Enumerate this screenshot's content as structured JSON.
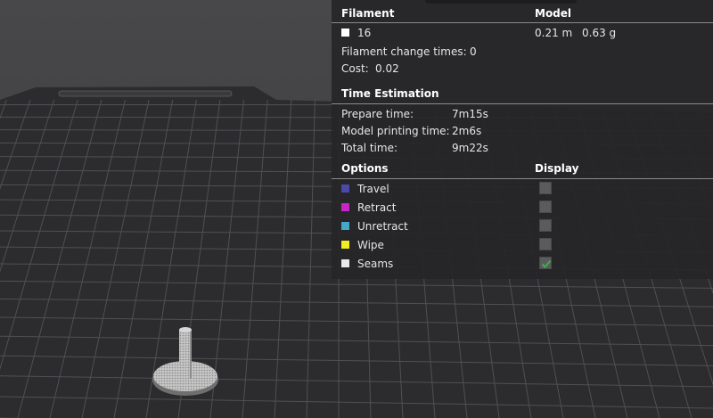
{
  "filament": {
    "header": "Filament",
    "model_header": "Model",
    "color": "#ffffff",
    "name": "16",
    "length": "0.21 m",
    "weight": "0.63 g",
    "change_times_label": "Filament change times:",
    "change_times_value": "0",
    "cost_label": "Cost:",
    "cost_value": "0.02"
  },
  "time": {
    "header": "Time Estimation",
    "prepare_label": "Prepare time:",
    "prepare_value": "7m15s",
    "model_label": "Model printing time:",
    "model_value": "2m6s",
    "total_label": "Total time:",
    "total_value": "9m22s"
  },
  "options": {
    "header": "Options",
    "display_header": "Display",
    "items": [
      {
        "label": "Travel",
        "color": "#4a4aa8",
        "checked": false
      },
      {
        "label": "Retract",
        "color": "#c626c6",
        "checked": false
      },
      {
        "label": "Unretract",
        "color": "#45a8c8",
        "checked": false
      },
      {
        "label": "Wipe",
        "color": "#f0f020",
        "checked": false
      },
      {
        "label": "Seams",
        "color": "#e8e8e8",
        "checked": true
      }
    ]
  },
  "colors": {
    "check_mark": "#38b24a",
    "background": "#3c3c3e",
    "bed": "#2c2c2e"
  }
}
